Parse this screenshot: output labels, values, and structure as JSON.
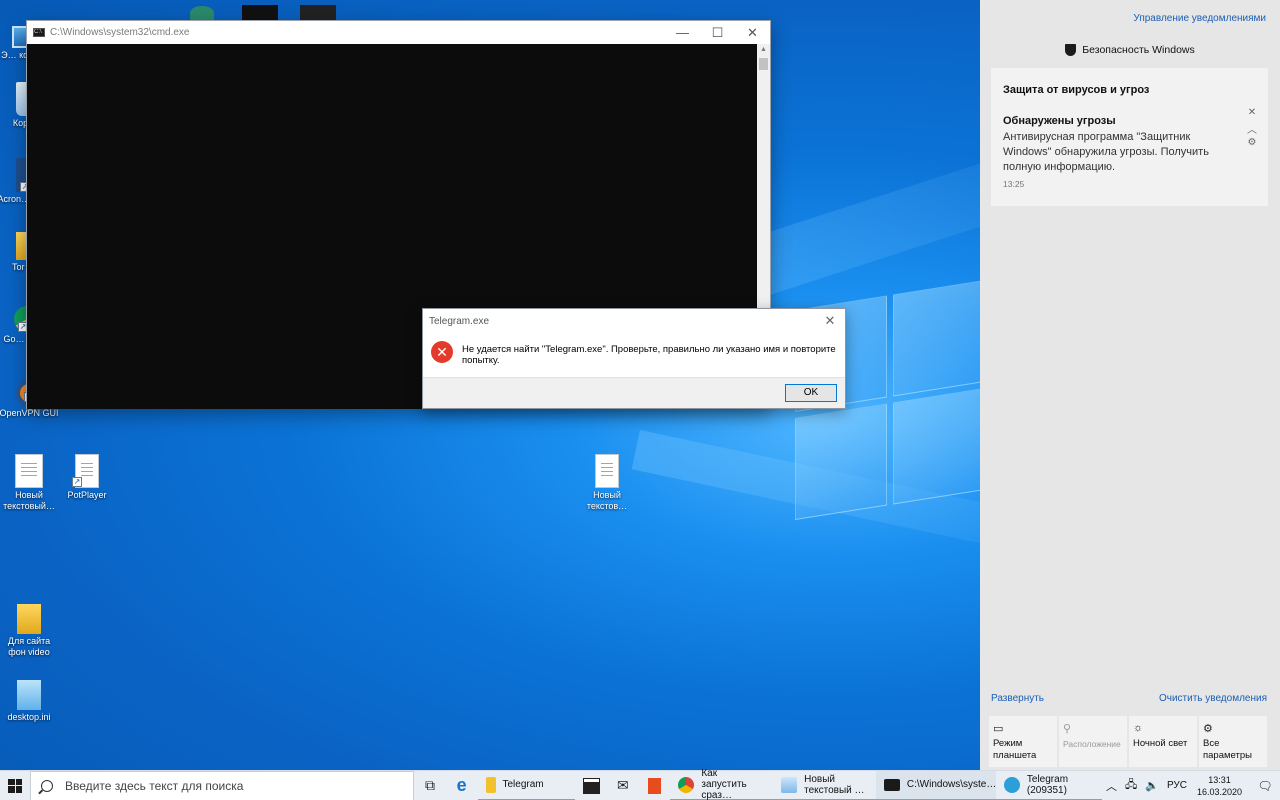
{
  "desktop": {
    "icons": [
      {
        "label": "Э… компь…",
        "kind": "monitor"
      },
      {
        "label": "Корз…",
        "kind": "recycle"
      },
      {
        "label": "Acron… Ima…",
        "kind": "app"
      },
      {
        "label": "Tor B…",
        "kind": "folder"
      },
      {
        "label": "Go… Chr…",
        "kind": "chrome"
      },
      {
        "label": "OpenVPN GUI",
        "kind": "vpn"
      },
      {
        "label": "Новый текстовый…",
        "kind": "doc"
      },
      {
        "label": "PotPlayer",
        "kind": "doc"
      },
      {
        "label": "Новый текстов…",
        "kind": "doc"
      },
      {
        "label": "Для сайта фон video",
        "kind": "folder"
      },
      {
        "label": "desktop.ini",
        "kind": "ini"
      }
    ]
  },
  "cmd_window": {
    "title": "C:\\Windows\\system32\\cmd.exe",
    "minimize": "—",
    "maximize": "☐",
    "close": "✕"
  },
  "error_dialog": {
    "title": "Telegram.exe",
    "close": "✕",
    "icon": "✕",
    "message": "Не удается найти \"Telegram.exe\". Проверьте, правильно ли указано имя и повторите попытку.",
    "ok_label": "OK"
  },
  "action_center": {
    "manage_label": "Управление уведомлениями",
    "app_name": "Безопасность Windows",
    "notification": {
      "heading": "Защита от вирусов и угроз",
      "title": "Обнаружены угрозы",
      "body": "Антивирусная программа \"Защитник Windows\" обнаружила угрозы. Получить полную информацию.",
      "time": "13:25",
      "close": "✕",
      "collapse": "︿",
      "settings": "⚙"
    },
    "expand_label": "Развернуть",
    "clear_label": "Очистить уведомления",
    "quick_actions": [
      {
        "icon": "▭",
        "label": "Режим планшета",
        "enabled": true
      },
      {
        "icon": "⚲",
        "label": "Расположение",
        "enabled": false
      },
      {
        "icon": "☼",
        "label": "Ночной свет",
        "enabled": true
      },
      {
        "icon": "⚙",
        "label": "Все параметры",
        "enabled": true
      }
    ]
  },
  "taskbar": {
    "search_placeholder": "Введите здесь текст для поиска",
    "pinned": [
      {
        "name": "task-view-icon",
        "glyph": "⧉"
      },
      {
        "name": "edge-icon",
        "glyph": "e"
      }
    ],
    "apps": [
      {
        "name": "telegram-folder",
        "label": "Telegram",
        "color": "#f2c12e"
      },
      {
        "name": "store",
        "label": "",
        "color": "#222222"
      },
      {
        "name": "mail",
        "label": "",
        "color": "#222222"
      },
      {
        "name": "office",
        "label": "",
        "color": "#e74c1c"
      },
      {
        "name": "chrome",
        "label": "Как запустить сраз…",
        "color": "#4caf50"
      },
      {
        "name": "notepad",
        "label": "Новый текстовый …",
        "color": "#7fb7e6"
      },
      {
        "name": "cmd",
        "label": "C:\\Windows\\syste…",
        "color": "#1a1a1a"
      },
      {
        "name": "telegram",
        "label": "Telegram (209351)",
        "color": "#2a9fd8"
      }
    ],
    "tray": {
      "chevron": "︿",
      "network": "🖧",
      "volume": "🔈",
      "lang": "РУС",
      "time": "13:31",
      "date": "16.03.2020",
      "notifications": "🗨"
    }
  }
}
